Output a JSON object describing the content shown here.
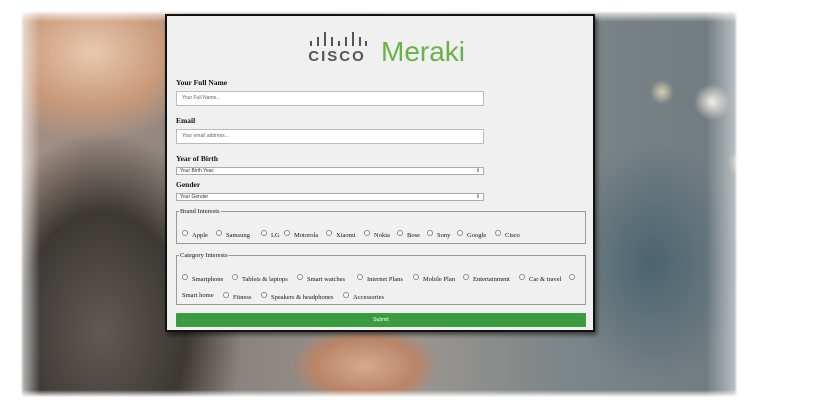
{
  "brand": {
    "cisco": "CISCO",
    "product": "Meraki",
    "accent": "#67b346"
  },
  "form": {
    "full_name": {
      "label": "Your Full Name",
      "placeholder": "Your Full Name..."
    },
    "email": {
      "label": "Email",
      "placeholder": "Your email address..."
    },
    "birth_year": {
      "label": "Year of Birth",
      "selected": "Your Birth Year:"
    },
    "gender": {
      "label": "Gender",
      "selected": "Your Gender"
    },
    "brand_interests": {
      "legend": "Brand Interests",
      "options": [
        "Apple",
        "Samsung",
        "LG",
        "Motorola",
        "Xiaomi",
        "Nokia",
        "Bose",
        "Sony",
        "Google",
        "Cisco"
      ]
    },
    "category_interests": {
      "legend": "Category Interests",
      "options": [
        "Smartphone",
        "Tablets & laptops",
        "Smart watches",
        "Internet Plans",
        "Mobile Plan",
        "Entertainment",
        "Car & travel",
        "Smart home",
        "Fitness",
        "Speakers & headphones",
        "Accessories"
      ]
    },
    "submit_label": "Submit",
    "submit_color": "#3b9b3f"
  }
}
